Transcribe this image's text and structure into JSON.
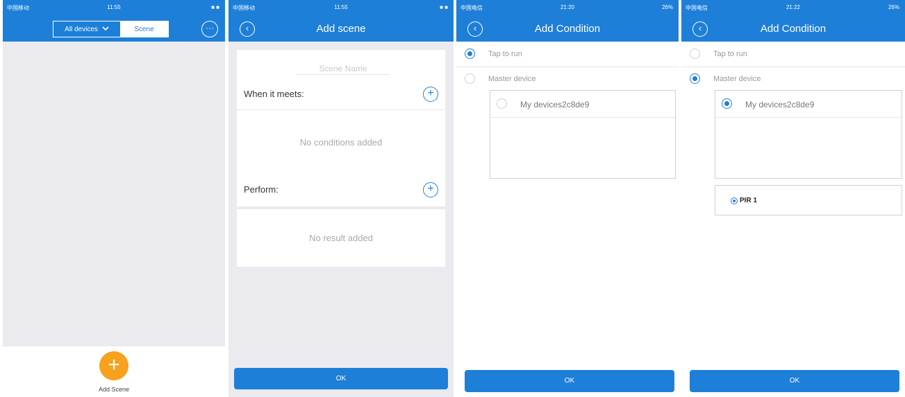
{
  "status": {
    "s1": {
      "carrier": "中国移动",
      "time": "11:55",
      "battery": "■ ■"
    },
    "s2": {
      "carrier": "中国移动",
      "time": "11:55",
      "battery": "■ ■"
    },
    "s3": {
      "carrier": "中国电信",
      "time": "21:20",
      "battery": "26%"
    },
    "s4": {
      "carrier": "中国电信",
      "time": "21:22",
      "battery": "26%"
    }
  },
  "screen1": {
    "segment_all_devices": "All devices",
    "segment_scene": "Scene",
    "add_scene_label": "Add Scene"
  },
  "screen2": {
    "title": "Add scene",
    "scene_name_placeholder": "Scene Name",
    "when_label": "When it meets:",
    "no_conditions": "No conditions added",
    "perform_label": "Perform:",
    "no_result": "No result added",
    "ok_label": "OK"
  },
  "screen3": {
    "title": "Add Condition",
    "tap_to_run": "Tap to run",
    "master_device": "Master device",
    "device_name": "My devices2c8de9",
    "ok_label": "OK"
  },
  "screen4": {
    "title": "Add Condition",
    "tap_to_run": "Tap to run",
    "master_device": "Master device",
    "device_name": "My devices2c8de9",
    "sensor_name": "PIR 1",
    "ok_label": "OK"
  },
  "colors": {
    "primary": "#1e7fd8",
    "accent": "#f7a11c",
    "background": "#ebebef"
  }
}
